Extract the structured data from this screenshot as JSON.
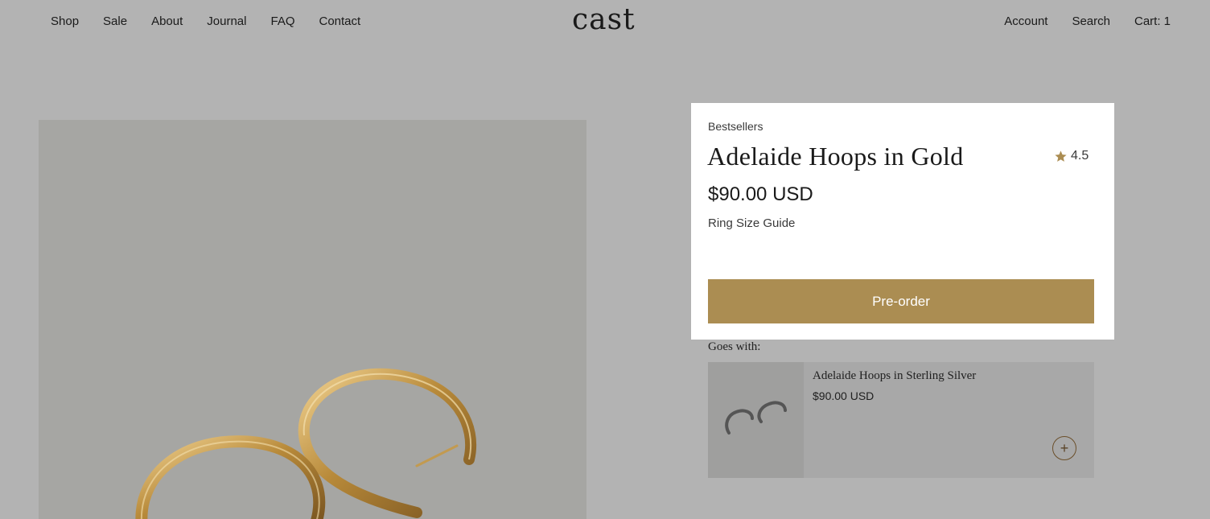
{
  "brand": {
    "logo_text": "cast"
  },
  "nav": {
    "left": [
      "Shop",
      "Sale",
      "About",
      "Journal",
      "FAQ",
      "Contact"
    ],
    "right": {
      "account": "Account",
      "search": "Search",
      "cart": "Cart: 1"
    }
  },
  "product": {
    "collection": "Bestsellers",
    "name": "Adelaide Hoops in Gold",
    "rating": "4.5",
    "price": "$90.00 USD",
    "size_guide": "Ring Size Guide",
    "cta": "Pre-order"
  },
  "goes_with": {
    "heading": "Goes with:",
    "item": {
      "name": "Adelaide Hoops in Sterling Silver",
      "price": "$90.00 USD"
    }
  },
  "colors": {
    "accent": "#ab8d52",
    "backdrop": "#b3b3b3",
    "panel": "#ffffff"
  },
  "icons": {
    "rating": "star-icon",
    "add": "plus-icon"
  }
}
